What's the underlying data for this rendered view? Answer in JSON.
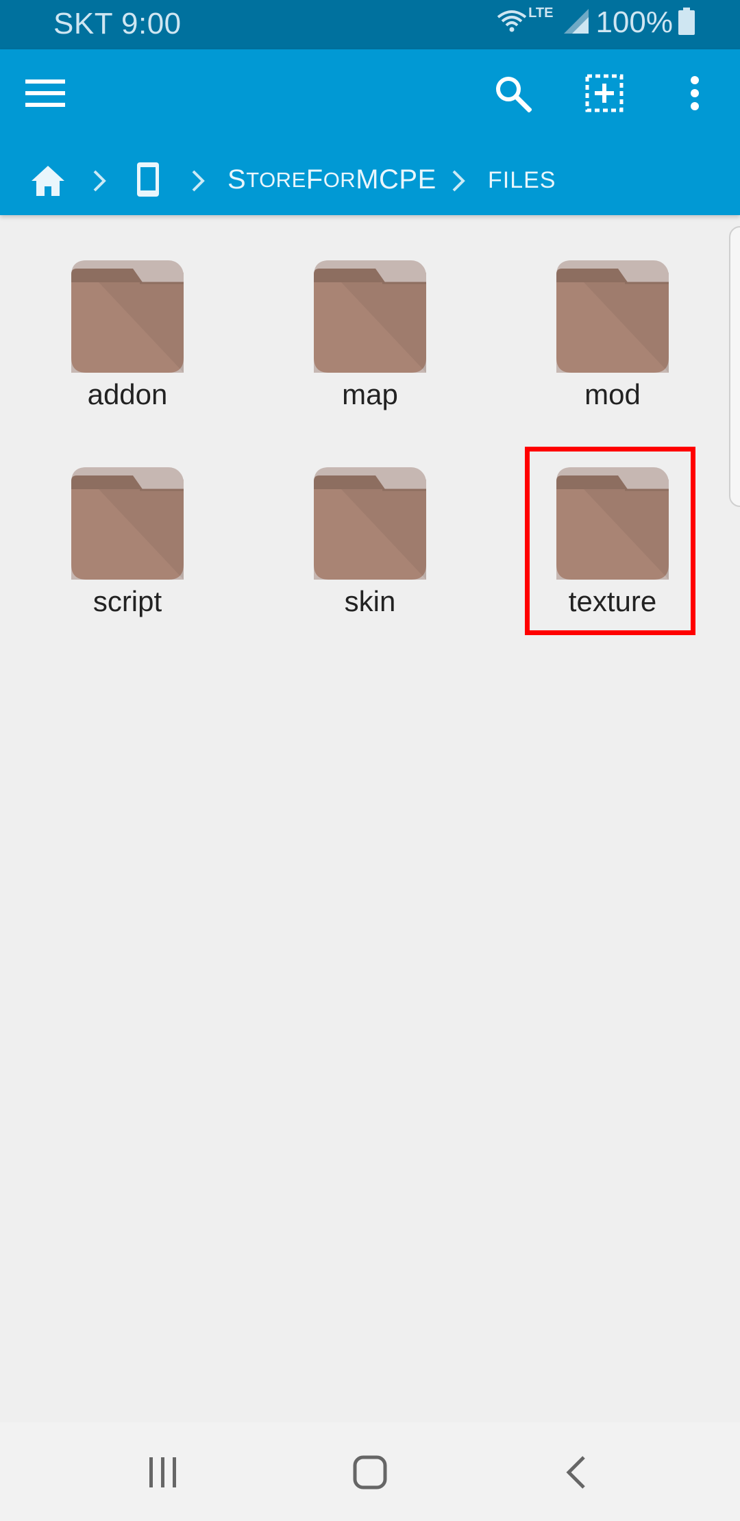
{
  "status_bar": {
    "carrier_time": "SKT 9:00",
    "network": "LTE",
    "battery": "100%"
  },
  "app_bar": {
    "icons": [
      "menu-icon",
      "search-icon",
      "select-icon",
      "more-vert-icon"
    ]
  },
  "breadcrumb": {
    "home_icon": "home-icon",
    "device_icon": "phone-icon",
    "folder_first": "S",
    "folder_rest1": "TORE",
    "folder_mid": "F",
    "folder_rest2": "OR",
    "folder_tail": "MCPE",
    "current": "FILES"
  },
  "folders": [
    {
      "label": "addon"
    },
    {
      "label": "map"
    },
    {
      "label": "mod"
    },
    {
      "label": "script"
    },
    {
      "label": "skin"
    },
    {
      "label": "texture"
    }
  ],
  "colors": {
    "status_bar": "#00719e",
    "app_bar": "#0199d4",
    "folder_body": "#a98474",
    "folder_tab": "#8d6e60",
    "folder_back": "#c6b7b2",
    "highlight": "#ff0000"
  },
  "nav_bar": {
    "icons": [
      "recent-apps-icon",
      "home-button-icon",
      "back-icon"
    ]
  }
}
